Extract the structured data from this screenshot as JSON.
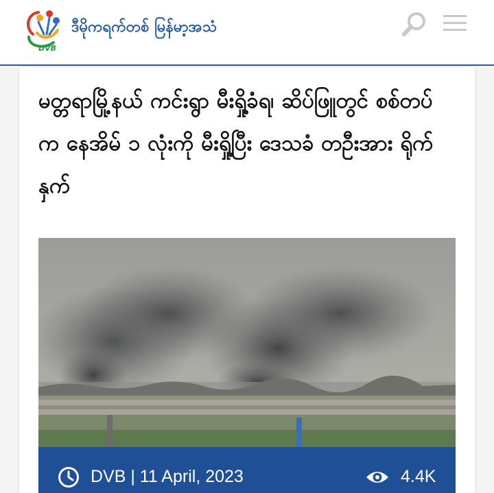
{
  "header": {
    "brand_text": "ဒီမိုကရက်တစ် မြန်မာ့အသံ",
    "logo_label": "DVB",
    "search_icon": "search-icon",
    "menu_icon": "hamburger-menu-icon",
    "accent_color": "#2f5aa0"
  },
  "article": {
    "title": "မတ္တရာမြို့နယ် ကင်းရွာ မီးရှို့ခံရ၊ ဆိပ်ဖြူတွင် စစ်တပ်က နေအိမ် ၁ လုံးကို မီးရှို့ပြီး ဒေသခံ တဦးအား ရိုက်နှက်",
    "image_alt": "smoke rising over field",
    "meta": {
      "byline": "DVB | 11 April, 2023",
      "views": "4.4K",
      "clock_icon": "clock-icon",
      "eye_icon": "eye-icon",
      "bar_color": "#1f4f96"
    }
  }
}
